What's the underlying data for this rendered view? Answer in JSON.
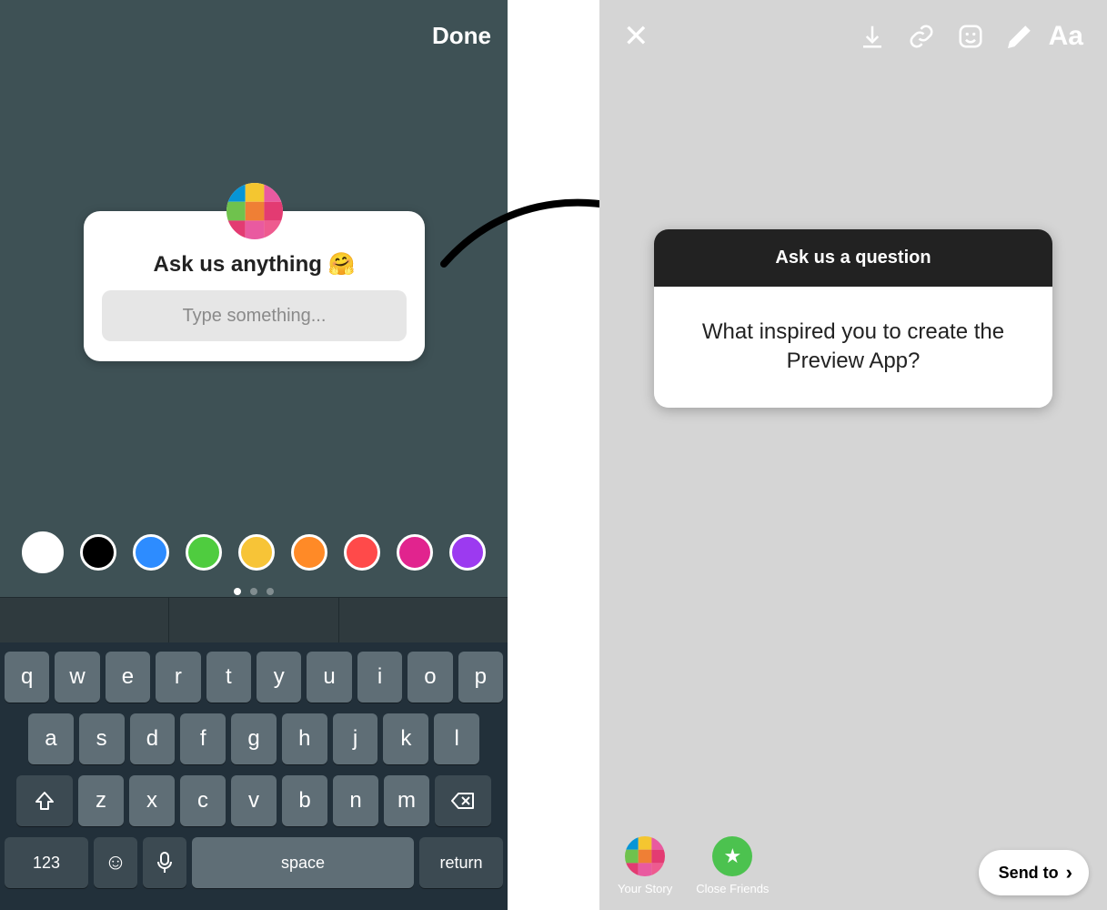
{
  "left": {
    "done_label": "Done",
    "question_prompt": "Ask us anything 🤗",
    "type_placeholder": "Type something...",
    "swatches": [
      "#ffffff",
      "#000000",
      "#2d8cff",
      "#4fcc3f",
      "#f7c437",
      "#ff8a27",
      "#ff4a4a",
      "#e1248e",
      "#9c3af0"
    ],
    "keyboard": {
      "row1": [
        "q",
        "w",
        "e",
        "r",
        "t",
        "y",
        "u",
        "i",
        "o",
        "p"
      ],
      "row2": [
        "a",
        "s",
        "d",
        "f",
        "g",
        "h",
        "j",
        "k",
        "l"
      ],
      "row3": [
        "z",
        "x",
        "c",
        "v",
        "b",
        "n",
        "m"
      ],
      "numbers_label": "123",
      "space_label": "space",
      "return_label": "return"
    }
  },
  "right": {
    "response_header": "Ask us a question",
    "response_body": "What inspired you to create the Preview App?",
    "share": {
      "your_story": "Your Story",
      "close_friends": "Close Friends"
    },
    "send_to": "Send to",
    "text_tool_label": "Aa"
  }
}
